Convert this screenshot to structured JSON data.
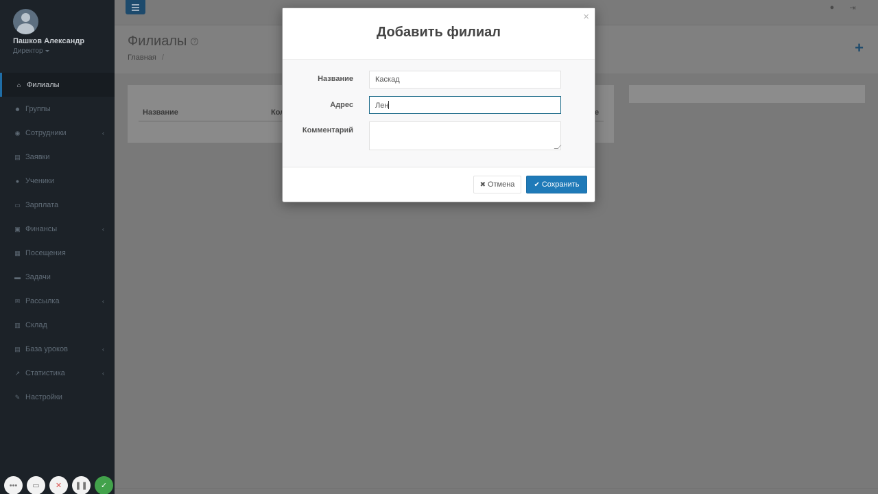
{
  "user": {
    "name": "Пашков Александр",
    "role": "Директор"
  },
  "sidebar": {
    "items": [
      {
        "label": "Филиалы",
        "icon": "bank-icon",
        "active": true,
        "has_arrow": false
      },
      {
        "label": "Группы",
        "icon": "users-icon",
        "active": false,
        "has_arrow": false
      },
      {
        "label": "Сотрудники",
        "icon": "user-circle-icon",
        "active": false,
        "has_arrow": true
      },
      {
        "label": "Заявки",
        "icon": "book-icon",
        "active": false,
        "has_arrow": false
      },
      {
        "label": "Ученики",
        "icon": "user-icon",
        "active": false,
        "has_arrow": false
      },
      {
        "label": "Зарплата",
        "icon": "credit-card-icon",
        "active": false,
        "has_arrow": false
      },
      {
        "label": "Финансы",
        "icon": "money-icon",
        "active": false,
        "has_arrow": true
      },
      {
        "label": "Посещения",
        "icon": "calendar-icon",
        "active": false,
        "has_arrow": false
      },
      {
        "label": "Задачи",
        "icon": "briefcase-icon",
        "active": false,
        "has_arrow": false
      },
      {
        "label": "Рассылка",
        "icon": "envelope-icon",
        "active": false,
        "has_arrow": true
      },
      {
        "label": "Склад",
        "icon": "archive-icon",
        "active": false,
        "has_arrow": false
      },
      {
        "label": "База уроков",
        "icon": "database-icon",
        "active": false,
        "has_arrow": true
      },
      {
        "label": "Статистика",
        "icon": "line-chart-icon",
        "active": false,
        "has_arrow": true
      },
      {
        "label": "Настройки",
        "icon": "wrench-icon",
        "active": false,
        "has_arrow": false
      }
    ]
  },
  "page": {
    "title": "Филиалы",
    "breadcrumb": "Главная",
    "breadcrumb_sep": "/",
    "table_headers": [
      "Название",
      "Кол",
      "е"
    ]
  },
  "modal": {
    "title": "Добавить филиал",
    "close": "×",
    "fields": {
      "name_label": "Название",
      "name_value": "Каскад",
      "address_label": "Адрес",
      "address_value": "Лен",
      "comment_label": "Комментарий",
      "comment_value": ""
    },
    "cancel_label": "Отмена",
    "save_label": "Сохранить"
  },
  "colors": {
    "sidebar_bg": "#1c2228",
    "accent": "#1f7ab8",
    "overlay_bg": "#797979"
  }
}
